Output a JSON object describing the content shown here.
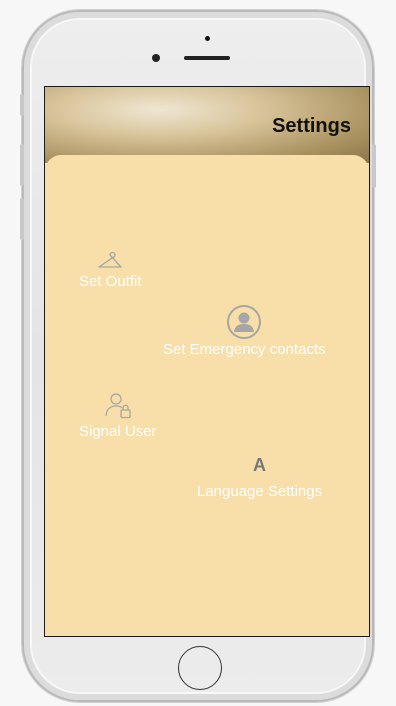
{
  "header": {
    "title": "Settings"
  },
  "menu": {
    "items": [
      {
        "label": "Set Outfit",
        "icon": "hanger-icon"
      },
      {
        "label": "Set Emergency contacts",
        "icon": "contact-avatar-icon"
      },
      {
        "label": "Signal User",
        "icon": "user-lock-icon"
      },
      {
        "label": "Language Settings",
        "icon": "letter-a-icon",
        "icon_text": "A"
      }
    ]
  },
  "colors": {
    "panel": "#f8dea9",
    "label": "#ffffff",
    "icon": "#a6a6a6"
  }
}
